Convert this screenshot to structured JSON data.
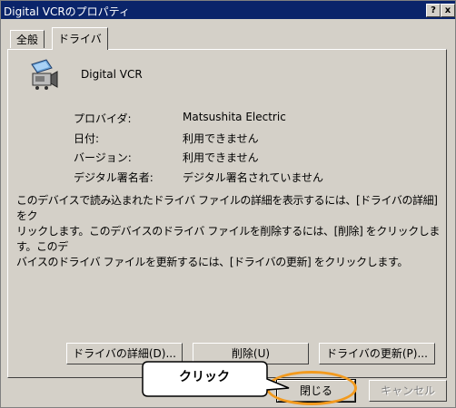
{
  "window": {
    "title": "Digital VCRのプロパティ",
    "help_button": "?",
    "close_button": "x"
  },
  "tabs": [
    {
      "label": "全般",
      "active": false
    },
    {
      "label": "ドライバ",
      "active": true
    }
  ],
  "device": {
    "icon": "digital-vcr-camera-icon",
    "name": "Digital VCR"
  },
  "properties": [
    {
      "label": "プロバイダ:",
      "value": "Matsushita Electric"
    },
    {
      "label": "日付:",
      "value": "利用できません"
    },
    {
      "label": "バージョン:",
      "value": "利用できません"
    },
    {
      "label": "デジタル署名者:",
      "value": "デジタル署名されていません"
    }
  ],
  "description": [
    "このデバイスで読み込まれたドライバ ファイルの詳細を表示するには、[ドライバの詳細] をク",
    "リックします。このデバイスのドライバ ファイルを削除するには、[削除] をクリックします。このデ",
    "バイスのドライバ ファイルを更新するには、[ドライバの更新] をクリックします。"
  ],
  "buttons": {
    "driver_details": "ドライバの詳細(D)...",
    "uninstall": "削除(U)",
    "update_driver": "ドライバの更新(P)...",
    "close": "閉じる",
    "cancel": "キャンセル"
  },
  "annotation": {
    "callout_text": "クリック",
    "highlight_color": "#f29a1e"
  }
}
